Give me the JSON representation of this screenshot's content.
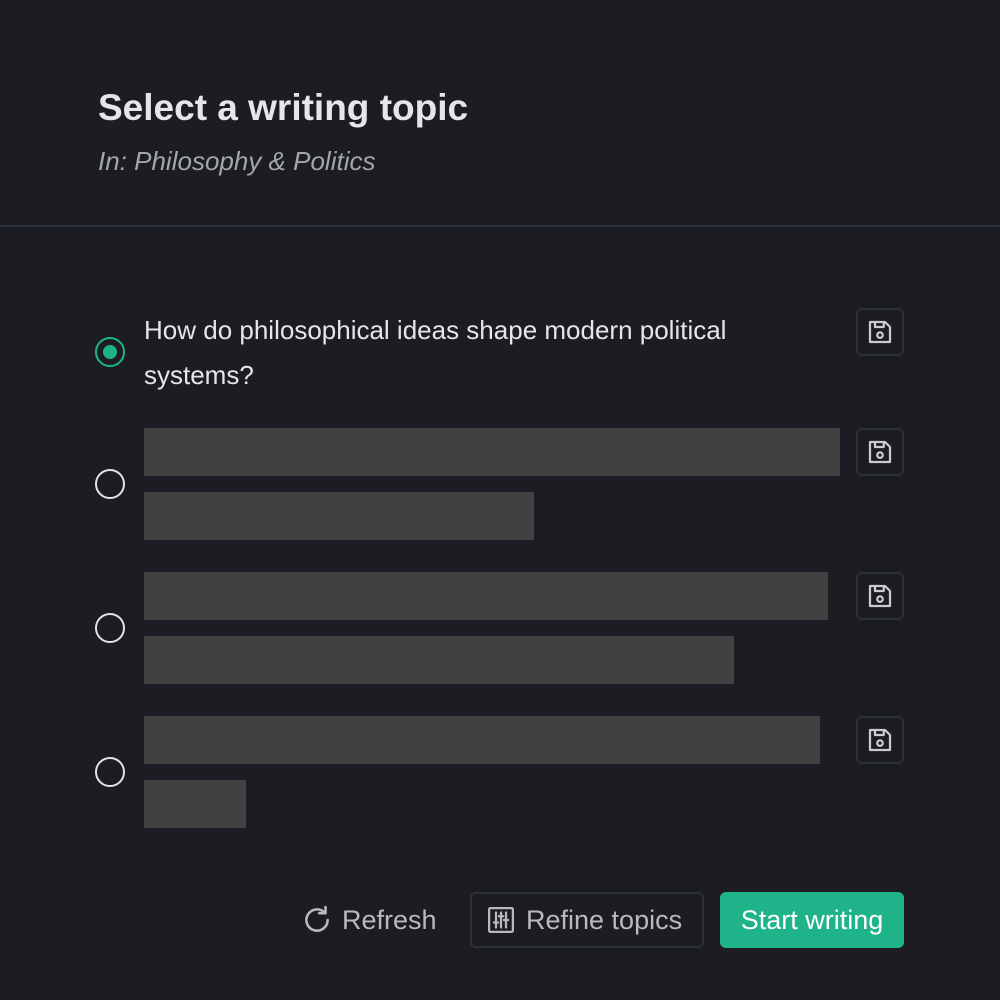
{
  "header": {
    "title": "Select a writing topic",
    "subtitle": "In: Philosophy & Politics"
  },
  "topics": [
    {
      "text": "How do philosophical ideas shape modern political systems?",
      "selected": true,
      "loaded": true,
      "save_icon": "save-icon"
    },
    {
      "text": "",
      "selected": false,
      "loaded": false,
      "save_icon": "save-icon"
    },
    {
      "text": "",
      "selected": false,
      "loaded": false,
      "save_icon": "save-icon"
    },
    {
      "text": "",
      "selected": false,
      "loaded": false,
      "save_icon": "save-icon"
    }
  ],
  "footer": {
    "refresh_label": "Refresh",
    "refresh_icon": "refresh-icon",
    "refine_label": "Refine topics",
    "refine_icon": "sliders-icon",
    "start_label": "Start writing"
  },
  "colors": {
    "accent": "#1fb38a",
    "background": "#1b1d23",
    "skeleton": "#414141"
  }
}
